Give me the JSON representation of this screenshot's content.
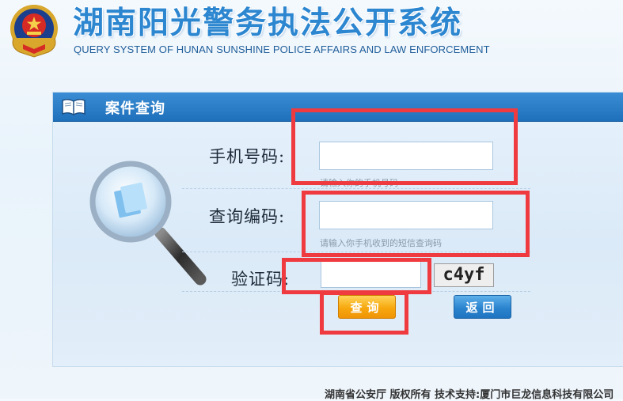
{
  "header": {
    "title": "湖南阳光警务执法公开系统",
    "subtitle": "QUERY SYSTEM OF HUNAN SUNSHINE POLICE AFFAIRS AND LAW ENFORCEMENT"
  },
  "panel": {
    "title": "案件查询"
  },
  "form": {
    "phone": {
      "label": "手机号码:",
      "value": "",
      "hint": "请输入你的手机号码"
    },
    "code": {
      "label": "查询编码:",
      "value": "",
      "hint": "请输入你手机收到的短信查询码"
    },
    "captcha": {
      "label": "验证码:",
      "value": "",
      "image_text": "c4yf"
    }
  },
  "buttons": {
    "query": "查询",
    "back": "返回"
  },
  "footer": {
    "text": "湖南省公安厅 版权所有 技术支持:厦门市巨龙信息科技有限公司"
  },
  "colors": {
    "title_blue": "#2c86d0",
    "panel_header": "#1f70bb",
    "query_button": "#f7a80f",
    "back_button": "#2b84cf",
    "annotation_red": "#ef3b3f"
  },
  "icons": [
    "police-emblem-icon",
    "book-icon",
    "magnifier-icon"
  ]
}
